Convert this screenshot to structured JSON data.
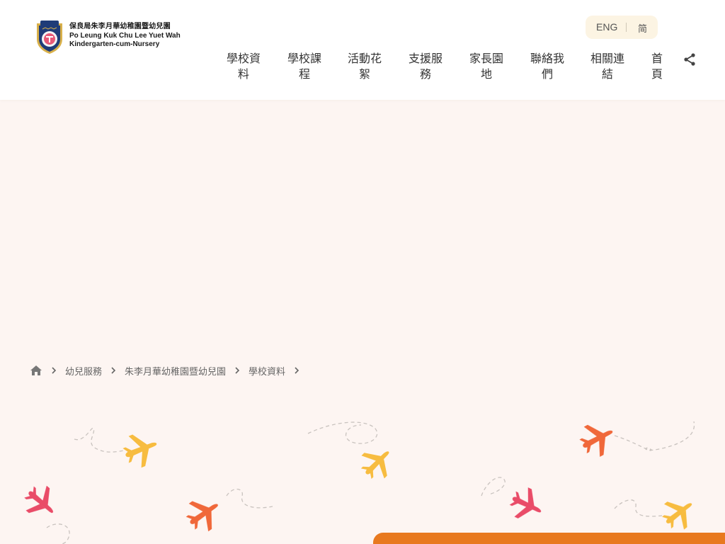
{
  "header": {
    "logo": {
      "name_cn": "保良局朱李月華幼稚園暨幼兒園",
      "name_en_line1": "Po Leung Kuk Chu Lee Yuet Wah",
      "name_en_line2": "Kindergarten-cum-Nursery",
      "crest_icon": "school-crest-icon",
      "crest_colors": {
        "shield": "#1f3c78",
        "inner": "#e85a78",
        "gold": "#d8b04a"
      }
    },
    "language": {
      "eng": "ENG",
      "simplified": "简"
    },
    "nav": [
      {
        "line1": "學校資",
        "line2": "料"
      },
      {
        "line1": "學校課",
        "line2": "程"
      },
      {
        "line1": "活動花",
        "line2": "絮"
      },
      {
        "line1": "支援服",
        "line2": "務"
      },
      {
        "line1": "家長園",
        "line2": "地"
      },
      {
        "line1": "聯絡我",
        "line2": "們"
      },
      {
        "line1": "相關連",
        "line2": "結"
      },
      {
        "line1": "首",
        "line2": "頁"
      }
    ],
    "share_icon": "share-icon"
  },
  "breadcrumb": {
    "home_icon": "home-icon",
    "items": [
      "幼兒服務",
      "朱李月華幼稚園暨幼兒園",
      "學校資料"
    ]
  },
  "theme": {
    "page_bg": "#fdf5f2",
    "accent_orange": "#e8791f",
    "plane_colors": [
      "#f7b731",
      "#ef5b2a",
      "#e83c5c"
    ]
  }
}
